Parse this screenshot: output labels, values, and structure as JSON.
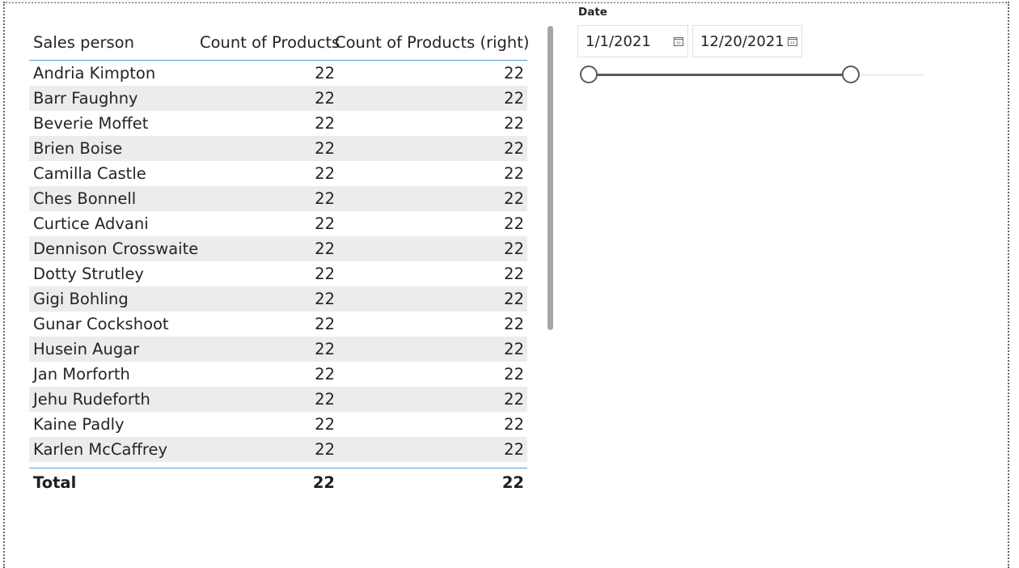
{
  "table": {
    "columns": [
      "Sales person",
      "Count of Products",
      "Count of Products (right)"
    ],
    "rows": [
      [
        "Andria Kimpton",
        "22",
        "22"
      ],
      [
        "Barr Faughny",
        "22",
        "22"
      ],
      [
        "Beverie Moffet",
        "22",
        "22"
      ],
      [
        "Brien Boise",
        "22",
        "22"
      ],
      [
        "Camilla Castle",
        "22",
        "22"
      ],
      [
        "Ches Bonnell",
        "22",
        "22"
      ],
      [
        "Curtice Advani",
        "22",
        "22"
      ],
      [
        "Dennison Crosswaite",
        "22",
        "22"
      ],
      [
        "Dotty Strutley",
        "22",
        "22"
      ],
      [
        "Gigi Bohling",
        "22",
        "22"
      ],
      [
        "Gunar Cockshoot",
        "22",
        "22"
      ],
      [
        "Husein Augar",
        "22",
        "22"
      ],
      [
        "Jan Morforth",
        "22",
        "22"
      ],
      [
        "Jehu Rudeforth",
        "22",
        "22"
      ],
      [
        "Kaine Padly",
        "22",
        "22"
      ],
      [
        "Karlen McCaffrey",
        "22",
        "22"
      ]
    ],
    "total": [
      "Total",
      "22",
      "22"
    ]
  },
  "slicer": {
    "title": "Date",
    "start": "1/1/2021",
    "end": "12/20/2021",
    "start_icon": "calendar-icon",
    "end_icon": "calendar-icon",
    "range_fraction": [
      0.0,
      0.78
    ]
  },
  "colors": {
    "accent_line": "#5b9bd5",
    "alt_row": "#ececec",
    "slider": "#5a5a5a"
  }
}
